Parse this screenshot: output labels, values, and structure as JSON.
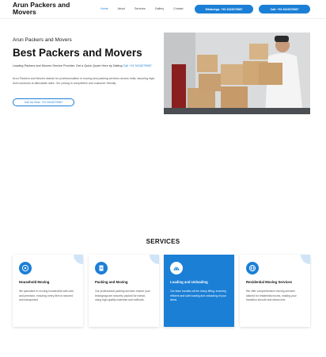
{
  "header": {
    "logo": "Arun Packers and Movers",
    "nav": [
      "Home",
      "About",
      "Services",
      "Gallery",
      "Contact"
    ],
    "whatsapp_button": "WhatsApp: +91 9415279987",
    "call_button": "Call: +91 9415279987"
  },
  "hero": {
    "subtitle": "Arun Packers and Movers",
    "title": "Best Packers and Movers",
    "line_text": "Leading Packers and Movers Service Provider. Get a Quick Quote Here by Dialing",
    "line_phone": "Call +91 9415279987",
    "description": "Arun Packers and Movers stands for professionalism in moving and packing services across India, assuring high-level solutions at affordable rates. Our pricing is competitive and customer friendly.",
    "cta": "Call Us Now: +91 9415279987"
  },
  "services": {
    "title": "SERVICES",
    "cards": [
      {
        "title": "Household Moving",
        "desc": "We specialize in moving households with care and precision, ensuring every item is secured and transported.",
        "icon": "truck-icon",
        "active": false
      },
      {
        "title": "Packing and Moving",
        "desc": "Our professional packing services ensure your belongings are securely packed for transit, using high-quality materials and methods.",
        "icon": "document-icon",
        "active": false
      },
      {
        "title": "Loading and Unloading",
        "desc": "Our team handles all the heavy lifting, ensuring efficient and safe loading and unloading of your items.",
        "icon": "weight-icon",
        "active": true
      },
      {
        "title": "Residential Moving Services",
        "desc": "We offer comprehensive moving services tailored for residential moves, making your transition smooth and stress-free.",
        "icon": "globe-icon",
        "active": false
      }
    ]
  },
  "colors": {
    "accent": "#1b7fd6"
  }
}
